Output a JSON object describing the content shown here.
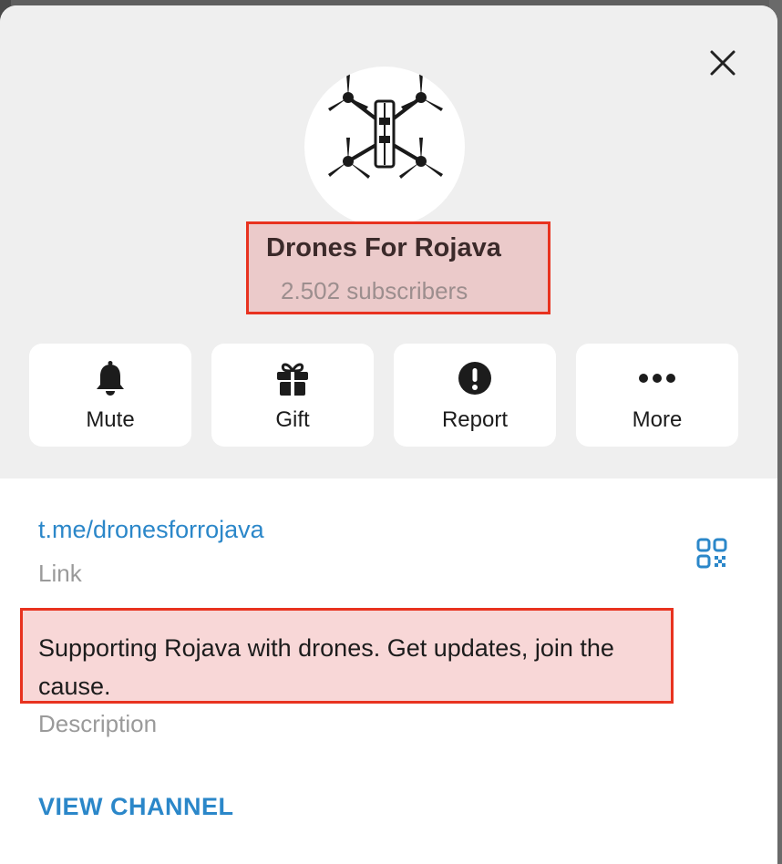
{
  "channel": {
    "name": "Drones For Rojava",
    "subscribers": "2.502 subscribers",
    "avatar_icon": "quad-drone-avatar"
  },
  "actions": [
    {
      "label": "Mute",
      "icon": "bell-icon"
    },
    {
      "label": "Gift",
      "icon": "gift-icon"
    },
    {
      "label": "Report",
      "icon": "exclamation-icon"
    },
    {
      "label": "More",
      "icon": "more-dots-icon"
    }
  ],
  "info": {
    "link": "t.me/dronesforrojava",
    "link_caption": "Link",
    "description": "Supporting Rojava with drones. Get updates, join the cause.",
    "description_caption": "Description"
  },
  "footer": {
    "view_channel": "VIEW CHANNEL"
  },
  "colors": {
    "accent": "#2b87c9",
    "highlight_border": "#e8321f",
    "header_bg": "#efefef"
  }
}
